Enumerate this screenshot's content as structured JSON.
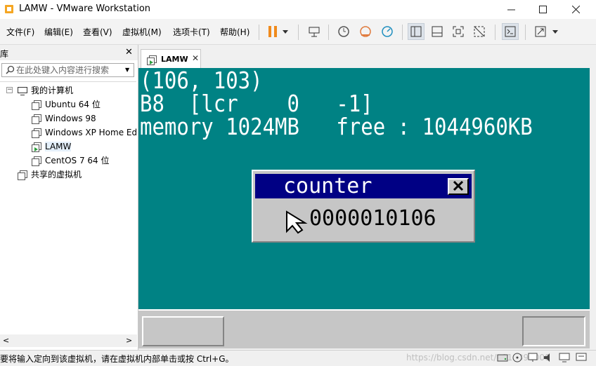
{
  "window": {
    "title": "LAMW - VMware Workstation"
  },
  "menu": [
    "文件(F)",
    "编辑(E)",
    "查看(V)",
    "虚拟机(M)",
    "选项卡(T)",
    "帮助(H)"
  ],
  "library": {
    "title": "库",
    "search_placeholder": "在此处键入内容进行搜索",
    "root": "我的计算机",
    "vms": [
      "Ubuntu 64 位",
      "Windows 98",
      "Windows XP Home Ed",
      "LAMW",
      "CentOS 7 64 位"
    ],
    "selected": "LAMW",
    "shared": "共享的虚拟机"
  },
  "tab": {
    "label": "LAMW"
  },
  "vm_screen": {
    "lines": [
      "(106, 103)",
      "B8  [lcr    0   -1]",
      "memory 1024MB   free : 1044960KB"
    ],
    "dialog_title": "counter",
    "dialog_value": "0000010106",
    "bg_color": "#008284",
    "title_color": "#000084"
  },
  "status": {
    "text": "要将输入定向到该虚拟机，请在虚拟机内部单击或按 Ctrl+G。",
    "watermark": "https://blog.csdn.net/u010390000"
  }
}
